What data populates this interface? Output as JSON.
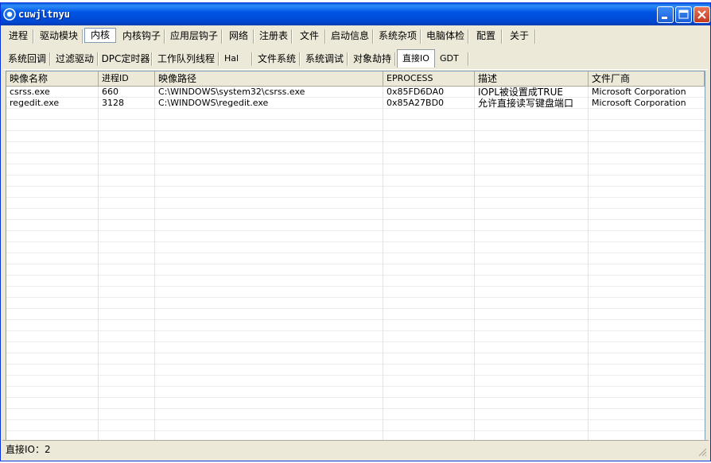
{
  "window": {
    "title": "cuwjltnyu",
    "menu_tabs": [
      "进程",
      "驱动模块",
      "内核",
      "内核钩子",
      "应用层钩子",
      "网络",
      "注册表",
      "文件",
      "启动信息",
      "系统杂项",
      "电脑体检",
      "配置",
      "关于"
    ],
    "active_menu_tab": "内核",
    "sub_tabs": [
      "系统回调",
      "过滤驱动",
      "DPC定时器",
      "工作队列线程",
      "Hal",
      "文件系统",
      "系统调试",
      "对象劫持",
      "直接IO",
      "GDT"
    ],
    "active_sub_tab": "直接IO"
  },
  "table": {
    "columns": [
      "映像名称",
      "进程ID",
      "映像路径",
      "EPROCESS",
      "描述",
      "文件厂商"
    ],
    "rows": [
      [
        "csrss.exe",
        "660",
        "C:\\WINDOWS\\system32\\csrss.exe",
        "0x85FD6DA0",
        "IOPL被设置成TRUE",
        "Microsoft Corporation"
      ],
      [
        "regedit.exe",
        "3128",
        "C:\\WINDOWS\\regedit.exe",
        "0x85A27BD0",
        "允许直接读写键盘端口",
        "Microsoft Corporation"
      ]
    ]
  },
  "status": {
    "text": "直接IO：2"
  },
  "icons": {
    "app": "app-icon",
    "minimize": "minimize-icon",
    "maximize": "maximize-icon",
    "close": "close-icon"
  },
  "colors": {
    "titlebar": "#0055e5",
    "window_bg": "#ece9d8",
    "close_button": "#c4391f"
  }
}
